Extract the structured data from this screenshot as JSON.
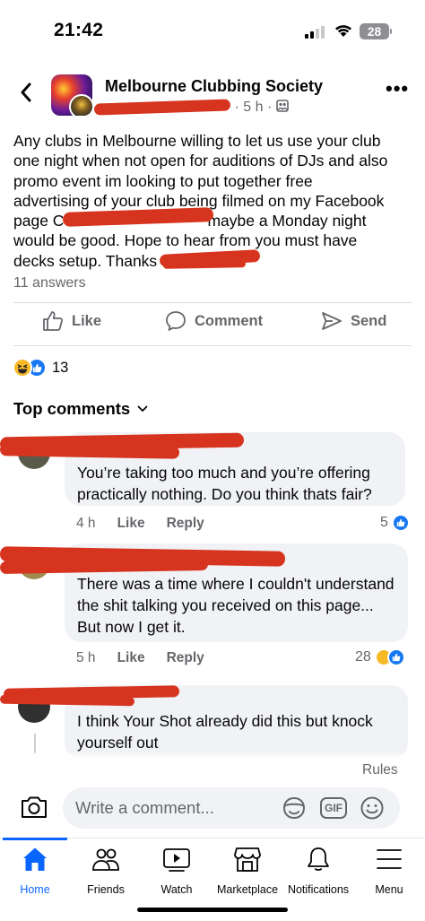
{
  "status_bar": {
    "time": "21:42",
    "battery": "28"
  },
  "post": {
    "group_name": "Melbourne Clubbing Society",
    "time_ago": "5 h",
    "body_lines": [
      "Any clubs in Melbourne willing to let us use your club",
      "one night when not open for auditions of DJs and also",
      "promo event im looking to put together free",
      "advertising of your club being filmed on my Facebook",
      "page C",
      "maybe a Monday night",
      "would be good. Hope to hear from you must have",
      "decks setup. Thanks"
    ],
    "answers": "11 answers",
    "reaction_count": "13"
  },
  "actions": {
    "like": "Like",
    "comment": "Comment",
    "send": "Send"
  },
  "top_comments_label": "Top comments",
  "comments": [
    {
      "text": "You’re taking too much and you’re offering practically nothing. Do you think thats fair?",
      "time": "4 h",
      "like": "Like",
      "reply": "Reply",
      "reactions": "5"
    },
    {
      "text": "There was a time where I couldn't understand the shit talking you received on this page... But now I get it.",
      "time": "5 h",
      "like": "Like",
      "reply": "Reply",
      "reactions": "28"
    },
    {
      "text": "I think Your Shot already did this but knock yourself out"
    }
  ],
  "rules": "Rules",
  "composer": {
    "placeholder": "Write a comment...",
    "gif": "GIF"
  },
  "tabs": [
    {
      "label": "Home",
      "icon": "home-icon"
    },
    {
      "label": "Friends",
      "icon": "friends-icon"
    },
    {
      "label": "Watch",
      "icon": "watch-icon"
    },
    {
      "label": "Marketplace",
      "icon": "marketplace-icon"
    },
    {
      "label": "Notifications",
      "icon": "bell-icon"
    },
    {
      "label": "Menu",
      "icon": "menu-icon"
    }
  ],
  "colors": {
    "accent": "#0866ff",
    "redaction": "#d6341f",
    "secondary_text": "#65676b",
    "bubble": "#f0f2f5"
  }
}
